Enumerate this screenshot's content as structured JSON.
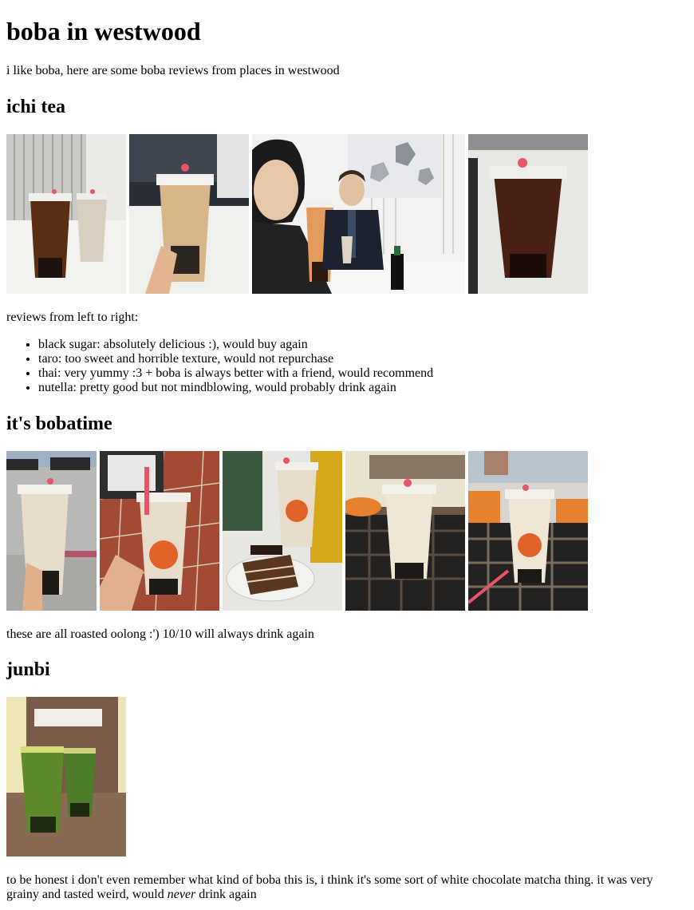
{
  "page": {
    "title": "boba in westwood",
    "intro": "i like boba, here are some boba reviews from places in westwood"
  },
  "sections": [
    {
      "heading": "ichi tea",
      "reviews_intro": "reviews from left to right:",
      "reviews": [
        "black sugar: absolutely delicious :), would buy again",
        "taro: too sweet and horrible texture, would not repurchase",
        "thai: very yummy :3 + boba is always better with a friend, would recommend",
        "nutella: pretty good but not mindblowing, would probably drink again"
      ]
    },
    {
      "heading": "it's bobatime",
      "note": "these are all roasted oolong :') 10/10 will always drink again"
    },
    {
      "heading": "junbi",
      "note_before": "to be honest i don't even remember what kind of boba this is, i think it's some sort of white chocolate matcha thing. it was very grainy and tasted weird, would ",
      "note_em": "never",
      "note_after": " drink again"
    }
  ],
  "photo_labels": {
    "bobatime_cup": "bobatime",
    "tiramisu": "Tiramisu",
    "junbi_cup": "junbi"
  },
  "colors": {
    "black_sugar": "#5a2e12",
    "taro": "#d9cfc0",
    "thai": "#e39a5a",
    "nutella": "#4a1f14",
    "oolong": "#e8dccb",
    "matcha": "#5e8a2c",
    "bobatime_orange": "#e2622a",
    "lid_heart": "#e8556a"
  }
}
